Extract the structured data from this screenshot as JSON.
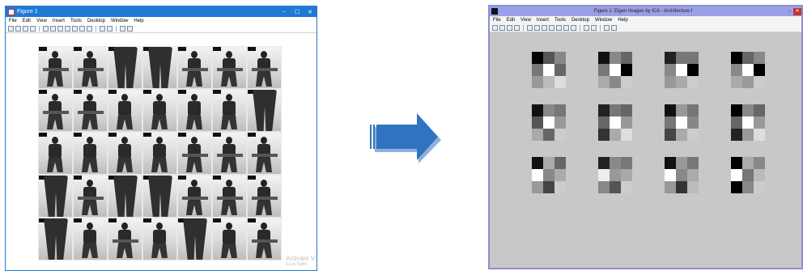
{
  "left_window": {
    "title": "Figure 1",
    "controls": {
      "minimize": "–",
      "maximize": "☐",
      "close": "✕"
    },
    "menu": [
      "File",
      "Edit",
      "View",
      "Insert",
      "Tools",
      "Desktop",
      "Window",
      "Help"
    ],
    "toolbar_icons": [
      "new-icon",
      "open-icon",
      "save-icon",
      "print-icon",
      "pointer-icon",
      "zoom-in-icon",
      "zoom-out-icon",
      "pan-icon",
      "rotate-icon",
      "datacursor-icon",
      "brush-icon",
      "link-icon",
      "colorbar-icon",
      "legend-icon",
      "plot-tools-icon"
    ],
    "photos": [
      "sit",
      "sit",
      "close",
      "close",
      "sit",
      "sit",
      "sit",
      "sit",
      "sit",
      "stand",
      "stand",
      "stand",
      "stand",
      "close",
      "stand",
      "stand",
      "stand",
      "stand",
      "sit",
      "sit",
      "sit",
      "close",
      "sit",
      "close",
      "close",
      "sit",
      "sit",
      "sit",
      "close",
      "stand",
      "sit",
      "stand",
      "close",
      "stand",
      "sit"
    ],
    "watermark": {
      "line1": "Activate V",
      "line2": "Go to Settin"
    }
  },
  "arrow": {
    "color": "#2f74c0",
    "shadow": "#8fb1dc"
  },
  "right_window": {
    "title": "Figure 1: Eigen Images by ICA - Architecture I",
    "controls": {
      "minimize": "–",
      "close": "✕"
    },
    "menu": [
      "File",
      "Edit",
      "View",
      "Insert",
      "Tools",
      "Desktop",
      "Window",
      "Help"
    ],
    "toolbar_icons": [
      "new-icon",
      "open-icon",
      "save-icon",
      "print-icon",
      "pointer-icon",
      "zoom-in-icon",
      "zoom-out-icon",
      "pan-icon",
      "rotate-icon",
      "datacursor-icon",
      "brush-icon",
      "link-icon",
      "colorbar-icon",
      "legend-icon",
      "plot-tools-icon"
    ],
    "eigen_images": [
      [
        "#000",
        "#555",
        "#888",
        "#777",
        "#fff",
        "#666",
        "#999",
        "#bbb",
        "#ddd"
      ],
      [
        "#111",
        "#888",
        "#666",
        "#777",
        "#fff",
        "#000",
        "#aaa",
        "#888",
        "#ccc"
      ],
      [
        "#222",
        "#777",
        "#777",
        "#888",
        "#fff",
        "#000",
        "#999",
        "#aaa",
        "#ccc"
      ],
      [
        "#000",
        "#666",
        "#888",
        "#888",
        "#fff",
        "#000",
        "#aaa",
        "#999",
        "#ccc"
      ],
      [
        "#111",
        "#888",
        "#777",
        "#555",
        "#fff",
        "#999",
        "#aaa",
        "#666",
        "#ccc"
      ],
      [
        "#222",
        "#777",
        "#666",
        "#666",
        "#fff",
        "#999",
        "#333",
        "#aaa",
        "#ddd"
      ],
      [
        "#111",
        "#999",
        "#777",
        "#777",
        "#fff",
        "#888",
        "#444",
        "#aaa",
        "#ccc"
      ],
      [
        "#000",
        "#888",
        "#666",
        "#666",
        "#fff",
        "#999",
        "#222",
        "#999",
        "#ddd"
      ],
      [
        "#111",
        "#aaa",
        "#666",
        "#fff",
        "#888",
        "#aaa",
        "#999",
        "#444",
        "#ccc"
      ],
      [
        "#222",
        "#888",
        "#777",
        "#eee",
        "#999",
        "#aaa",
        "#888",
        "#555",
        "#ccc"
      ],
      [
        "#111",
        "#999",
        "#777",
        "#fff",
        "#888",
        "#aaa",
        "#999",
        "#333",
        "#bbb"
      ],
      [
        "#000",
        "#aaa",
        "#888",
        "#fff",
        "#777",
        "#bbb",
        "#000",
        "#888",
        "#ccc"
      ]
    ]
  }
}
